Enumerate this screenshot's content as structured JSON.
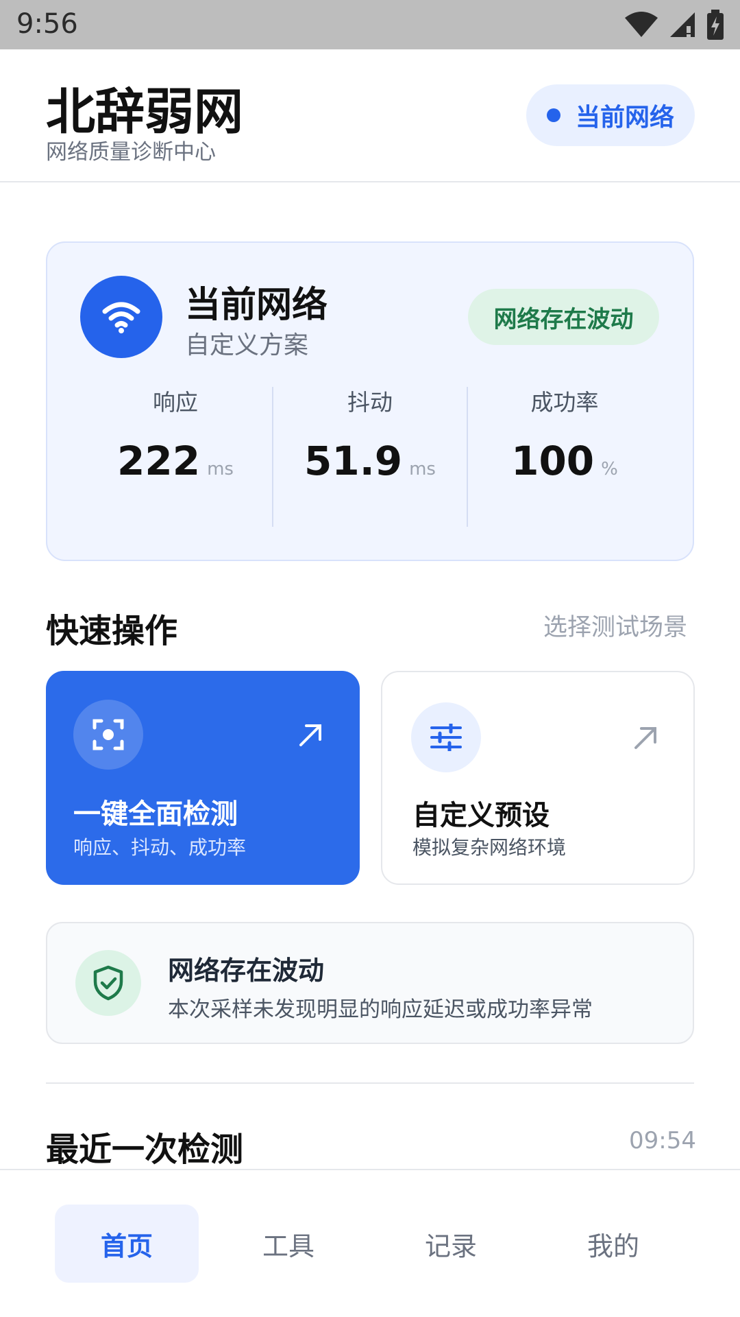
{
  "status_bar": {
    "time": "9:56"
  },
  "header": {
    "title": "北辞弱网",
    "subtitle": "网络质量诊断中心",
    "pill_label": "当前网络"
  },
  "network_card": {
    "title": "当前网络",
    "subtitle": "自定义方案",
    "status": "网络存在波动",
    "metrics": [
      {
        "label": "响应",
        "value": "222",
        "unit": "ms"
      },
      {
        "label": "抖动",
        "value": "51.9",
        "unit": "ms"
      },
      {
        "label": "成功率",
        "value": "100",
        "unit": "%"
      }
    ]
  },
  "quick_ops": {
    "title": "快速操作",
    "link": "选择测试场景",
    "cards": [
      {
        "title": "一键全面检测",
        "subtitle": "响应、抖动、成功率"
      },
      {
        "title": "自定义预设",
        "subtitle": "模拟复杂网络环境"
      }
    ]
  },
  "info": {
    "title": "网络存在波动",
    "subtitle": "本次采样未发现明显的响应延迟或成功率异常"
  },
  "recent": {
    "title": "最近一次检测",
    "time": "09:54"
  },
  "bottom_nav": {
    "items": [
      {
        "label": "首页",
        "active": true
      },
      {
        "label": "工具",
        "active": false
      },
      {
        "label": "记录",
        "active": false
      },
      {
        "label": "我的",
        "active": false
      }
    ]
  },
  "colors": {
    "accent": "#2563eb",
    "success": "#1e7a4a",
    "success_bg": "#dff3e7"
  }
}
